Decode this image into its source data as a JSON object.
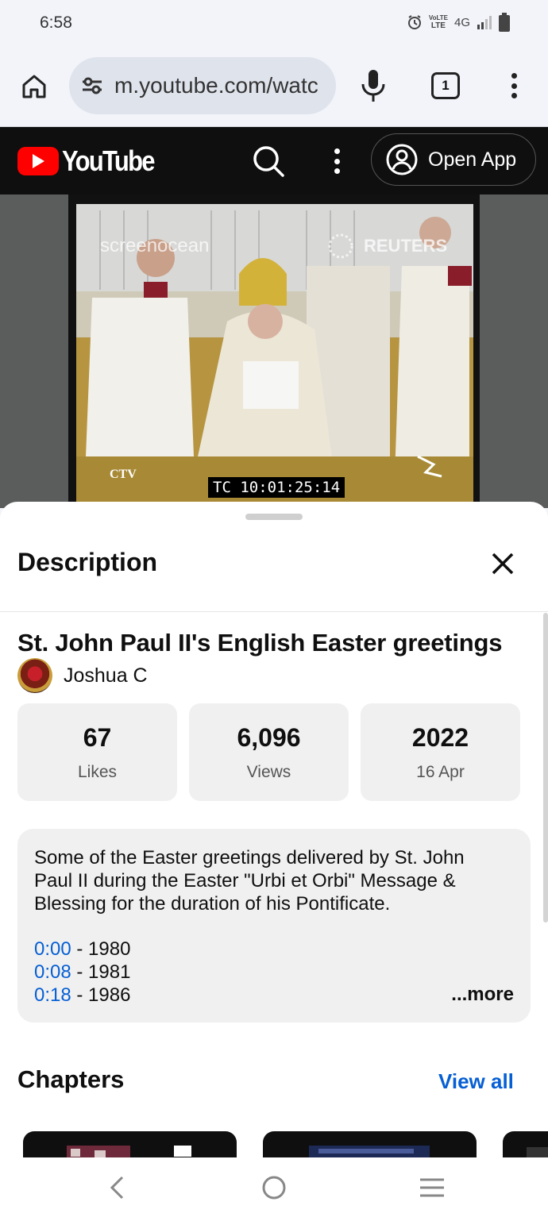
{
  "status_bar": {
    "time": "6:58",
    "network": "4G",
    "lte_label_top": "VoLTE",
    "lte_label": "LTE"
  },
  "browser": {
    "url": "m.youtube.com/watc",
    "tab_count": "1"
  },
  "youtube": {
    "logo_text": "YouTube",
    "open_app_label": "Open App"
  },
  "video": {
    "timecode": "TC 10:01:25:14",
    "overlay_left": "screenocean",
    "overlay_right": "REUTERS",
    "overlay_corner": "CTV"
  },
  "description_sheet": {
    "title": "Description",
    "video_title": "St. John Paul II's English Easter greetings",
    "channel_name": "Joshua C",
    "stats": [
      {
        "value": "67",
        "label": "Likes"
      },
      {
        "value": "6,096",
        "label": "Views"
      },
      {
        "value": "2022",
        "label": "16 Apr"
      }
    ],
    "description_text": "Some of the Easter greetings delivered by St. John Paul II during the Easter \"Urbi et Orbi\" Message & Blessing for the duration of his Pontificate.",
    "chapters_preview": [
      {
        "time": "0:00",
        "year": "1980"
      },
      {
        "time": "0:08",
        "year": "1981"
      },
      {
        "time": "0:18",
        "year": "1986"
      }
    ],
    "more_label": "...more",
    "chapters_heading": "Chapters",
    "view_all_label": "View all"
  }
}
